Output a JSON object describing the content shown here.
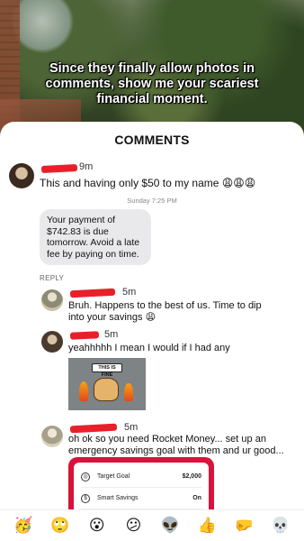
{
  "post": {
    "caption": "Since they finally allow photos in comments, show me your scariest financial moment."
  },
  "sheet": {
    "title": "COMMENTS",
    "reply_label": "REPLY"
  },
  "comments": [
    {
      "time": "9m",
      "text": "This and having only $50 to my name 😩😩😩"
    },
    {
      "time": "5m",
      "text": "Bruh. Happens to the best of us. Time to dip into your savings 😩"
    },
    {
      "time": "5m",
      "text": "yeahhhhh I mean I would if I had any"
    },
    {
      "time": "5m",
      "text": "oh ok so you need Rocket Money... set up an emergency savings goal with them and ur good..."
    }
  ],
  "imessage": {
    "date_label": "Sunday 7:25 PM",
    "bubble": "Your payment of $742.83 is due tomorrow. Avoid a late fee by paying on time."
  },
  "meme": {
    "text": "THIS IS FINE"
  },
  "app_card": {
    "rows": [
      {
        "icon": "target-icon",
        "label": "Target Goal",
        "value": "$2,000"
      },
      {
        "icon": "dollar-icon",
        "label": "Smart Savings",
        "value": "On"
      }
    ]
  },
  "reactions": [
    "🥳",
    "🙄",
    "😮",
    "😕",
    "👽",
    "👍",
    "🤛",
    "💀"
  ],
  "colors": {
    "redaction": "#e8202a",
    "app_brand": "#d9123b",
    "bubble_bg": "#e9e9eb"
  }
}
